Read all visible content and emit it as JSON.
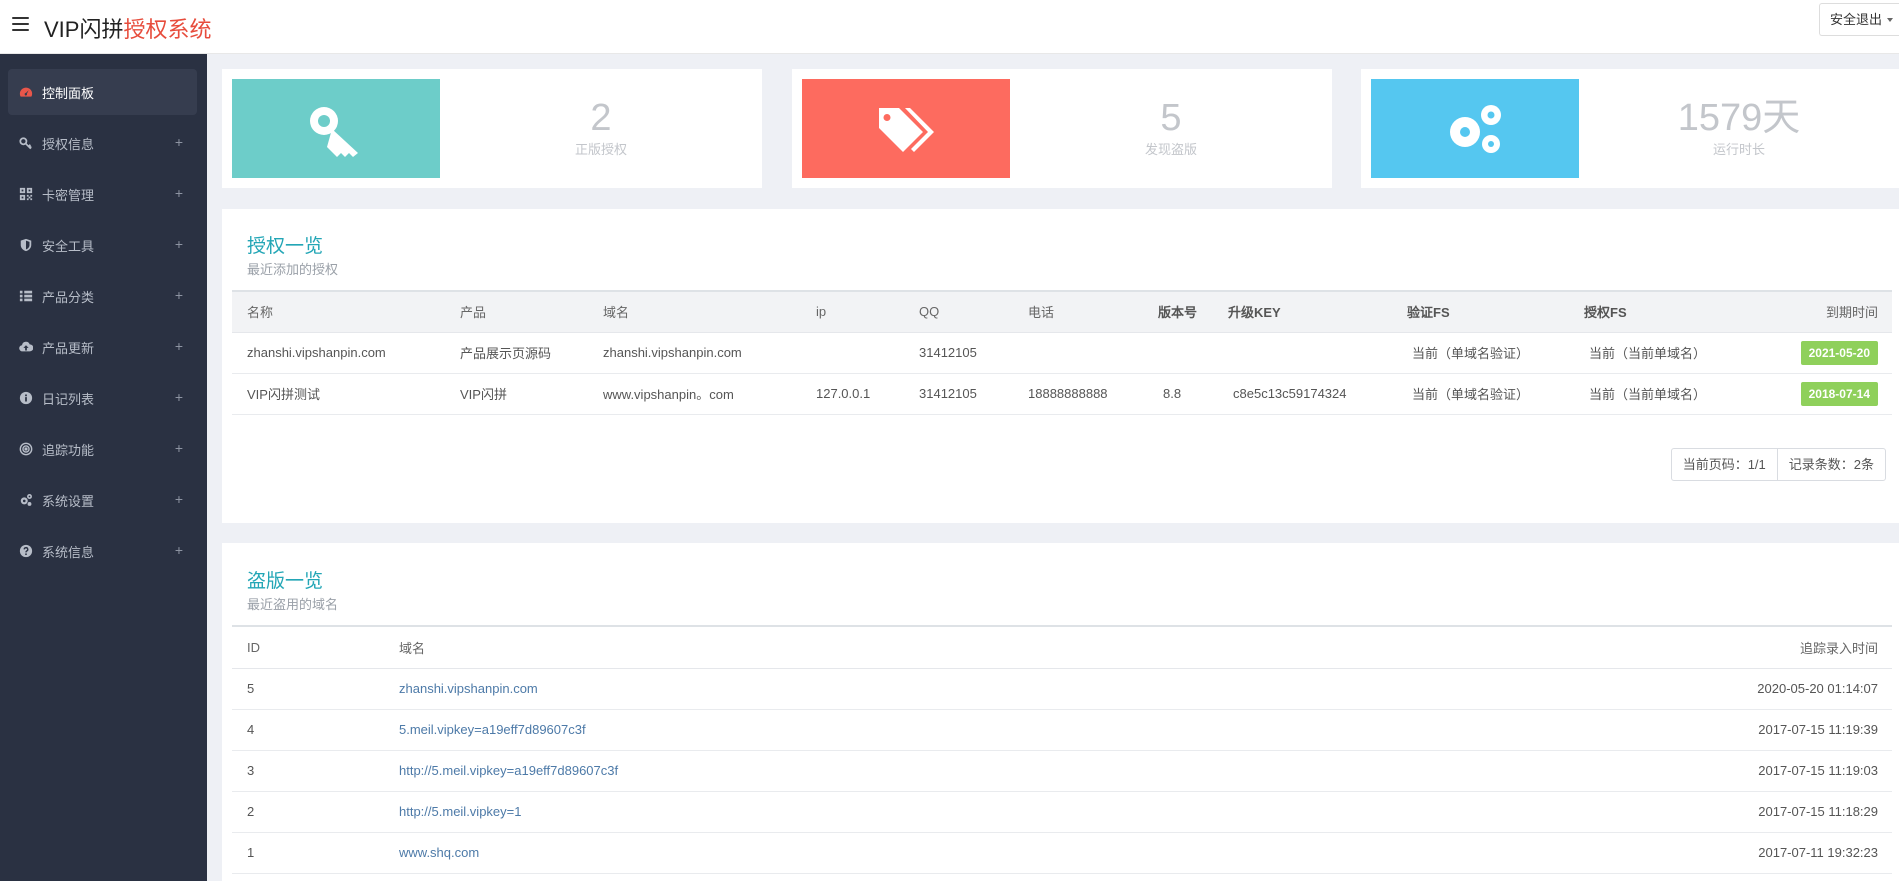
{
  "header": {
    "brand_prefix": "VIP闪拼",
    "brand_accent": "授权系统",
    "logout_label": "安全退出"
  },
  "sidebar": {
    "items": [
      {
        "label": "控制面板",
        "icon": "dashboard-icon",
        "active": true
      },
      {
        "label": "授权信息",
        "icon": "key-icon"
      },
      {
        "label": "卡密管理",
        "icon": "qrcode-icon"
      },
      {
        "label": "安全工具",
        "icon": "shield-icon"
      },
      {
        "label": "产品分类",
        "icon": "list-icon"
      },
      {
        "label": "产品更新",
        "icon": "cloud-upload-icon"
      },
      {
        "label": "日记列表",
        "icon": "info-icon"
      },
      {
        "label": "追踪功能",
        "icon": "target-icon"
      },
      {
        "label": "系统设置",
        "icon": "cogs-icon"
      },
      {
        "label": "系统信息",
        "icon": "question-icon"
      }
    ],
    "expand_symbol": "+"
  },
  "stats": [
    {
      "value": "2",
      "label": "正版授权",
      "icon": "key-icon",
      "color": "#6dcdc9"
    },
    {
      "value": "5",
      "label": "发现盗版",
      "icon": "tags-icon",
      "color": "#fd6b5f"
    },
    {
      "value": "1579天",
      "label": "运行时长",
      "icon": "cogs-icon",
      "color": "#55c7f0"
    }
  ],
  "auth_panel": {
    "title": "授权一览",
    "subtitle": "最近添加的授权",
    "columns": [
      "名称",
      "产品",
      "域名",
      "ip",
      "QQ",
      "电话",
      "版本号",
      "升级KEY",
      "验证FS",
      "授权FS",
      "到期时间"
    ],
    "rows": [
      {
        "name": "zhanshi.vipshanpin.com",
        "product": "产品展示页源码",
        "domain": "zhanshi.vipshanpin.com",
        "ip": "",
        "qq": "31412105",
        "phone": "",
        "version": "",
        "key": "",
        "verify_fs": "当前（单域名验证）",
        "auth_fs": "当前（当前单域名）",
        "expires": "2021-05-20"
      },
      {
        "name": "VIP闪拼测试",
        "product": "VIP闪拼",
        "domain": "www.vipshanpin。com",
        "ip": "127.0.0.1",
        "qq": "31412105",
        "phone": "18888888888",
        "version": "8.8",
        "key": "c8e5c13c59174324",
        "verify_fs": "当前（单域名验证）",
        "auth_fs": "当前（当前单域名）",
        "expires": "2018-07-14"
      }
    ],
    "badge_color": "#8fd05b",
    "pager": {
      "current_page": "当前页码：1/1",
      "record_count": "记录条数：2条"
    }
  },
  "piracy_panel": {
    "title": "盗版一览",
    "subtitle": "最近盗用的域名",
    "columns": [
      "ID",
      "域名",
      "追踪录入时间"
    ],
    "rows": [
      {
        "id": "5",
        "domain": "zhanshi.vipshanpin.com",
        "time": "2020-05-20 01:14:07"
      },
      {
        "id": "4",
        "domain": "5.meil.vipkey=a19eff7d89607c3f",
        "time": "2017-07-15 11:19:39"
      },
      {
        "id": "3",
        "domain": "http://5.meil.vipkey=a19eff7d89607c3f",
        "time": "2017-07-15 11:19:03"
      },
      {
        "id": "2",
        "domain": "http://5.meil.vipkey=1",
        "time": "2017-07-15 11:18:29"
      },
      {
        "id": "1",
        "domain": "www.shq.com",
        "time": "2017-07-11 19:32:23"
      }
    ]
  }
}
